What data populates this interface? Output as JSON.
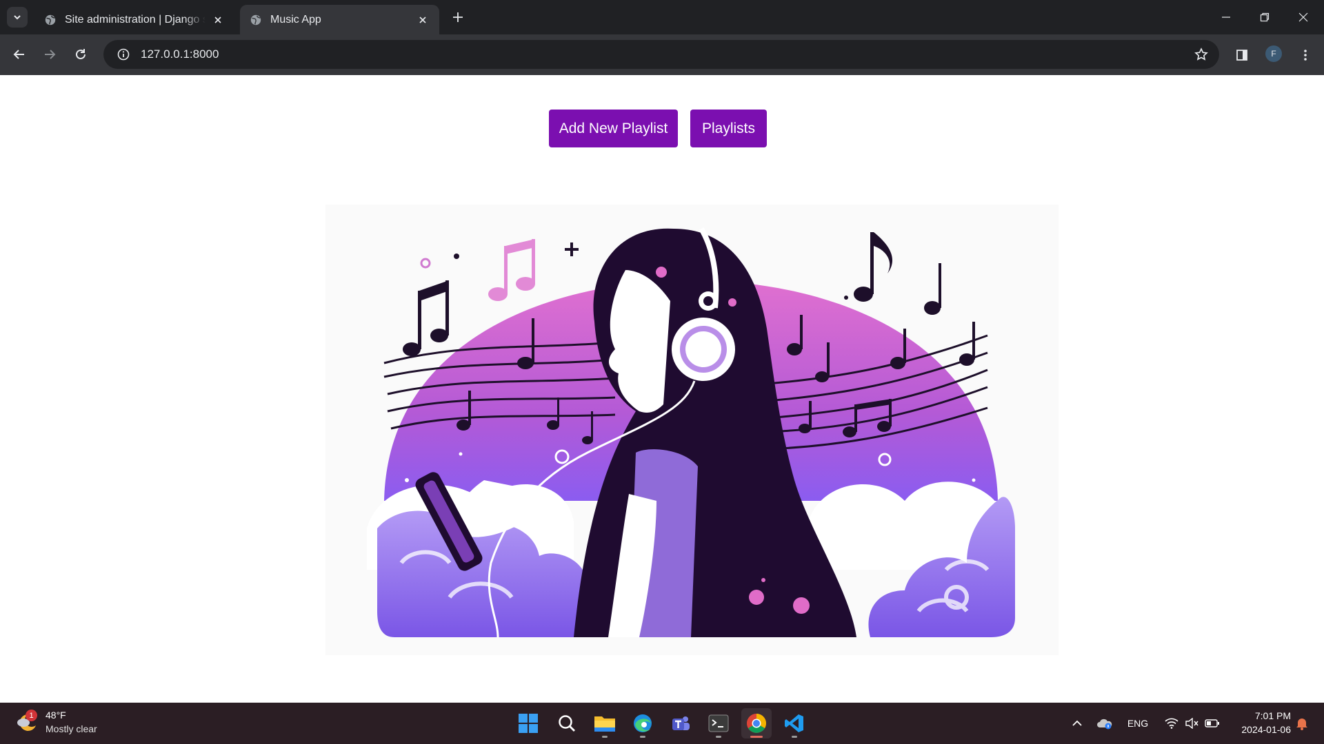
{
  "browser": {
    "tabs": [
      {
        "title": "Site administration | Django site admin",
        "active": false
      },
      {
        "title": "Music App",
        "active": true
      }
    ],
    "url": "127.0.0.1:8000",
    "profile_initial": "F"
  },
  "page": {
    "buttons": {
      "add_playlist": "Add New Playlist",
      "playlists": "Playlists"
    },
    "accent_color": "#7b0fb0"
  },
  "taskbar": {
    "weather": {
      "temp": "48°F",
      "desc": "Mostly clear",
      "badge": "1"
    },
    "language": "ENG",
    "time": "7:01 PM",
    "date": "2024-01-06"
  }
}
